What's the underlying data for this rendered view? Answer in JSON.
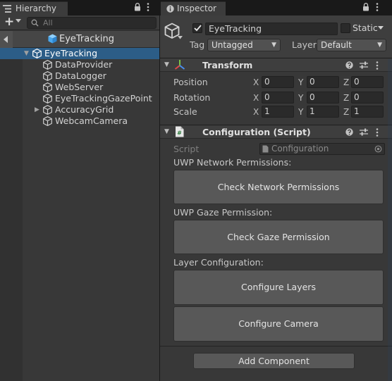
{
  "hierarchy": {
    "tab_label": "Hierarchy",
    "add_label": "+",
    "search_placeholder": "All",
    "scene_title": "EyeTracking",
    "root_item": "EyeTracking",
    "children": [
      "DataProvider",
      "DataLogger",
      "WebServer",
      "EyeTrackingGazePoint",
      "AccuracyGrid",
      "WebcamCamera"
    ]
  },
  "inspector": {
    "tab_label": "Inspector",
    "object_name": "EyeTracking",
    "static_label": "Static",
    "tag_label": "Tag",
    "tag_value": "Untagged",
    "layer_label": "Layer",
    "layer_value": "Default"
  },
  "transform": {
    "title": "Transform",
    "rows": [
      {
        "label": "Position",
        "x": "0",
        "y": "0",
        "z": "0"
      },
      {
        "label": "Rotation",
        "x": "0",
        "y": "0",
        "z": "0"
      },
      {
        "label": "Scale",
        "x": "1",
        "y": "1",
        "z": "1"
      }
    ],
    "axis_x": "X",
    "axis_y": "Y",
    "axis_z": "Z"
  },
  "configuration": {
    "title": "Configuration (Script)",
    "script_label": "Script",
    "script_value": "Configuration",
    "uwp_network_label": "UWP Network Permissions:",
    "check_network_button": "Check Network Permissions",
    "uwp_gaze_label": "UWP Gaze Permission:",
    "check_gaze_button": "Check Gaze Permission",
    "layer_config_label": "Layer Configuration:",
    "configure_layers_button": "Configure Layers",
    "configure_camera_button": "Configure Camera"
  },
  "add_component_button": "Add Component",
  "colors": {
    "selection": "#2c5d87",
    "panel": "#383838",
    "button": "#585858",
    "transform_icon_x": "#e04848",
    "transform_icon_y": "#7cc444",
    "transform_icon_z": "#4a8ef0"
  }
}
